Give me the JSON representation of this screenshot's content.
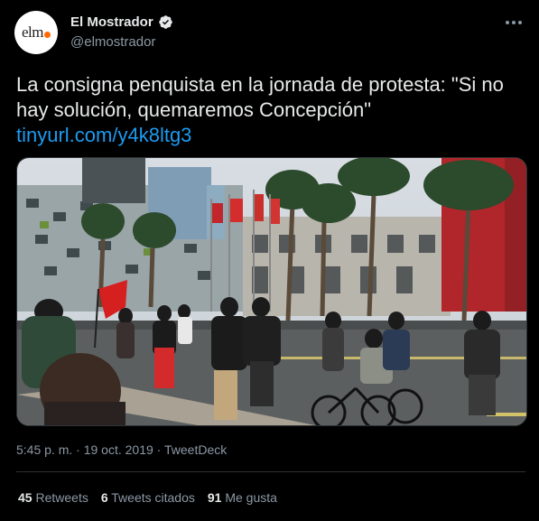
{
  "author": {
    "avatar_text": "elm",
    "display_name": "El Mostrador",
    "handle": "@elmostrador"
  },
  "tweet": {
    "text": "La consigna penquista en la jornada de protesta: \"Si no hay solución, quemaremos Concepción\"",
    "link": "tinyurl.com/y4k8ltg3"
  },
  "media": {
    "alt": "Protesters walking on a street with flags and palm trees, one carrying a red flag, people on bicycles"
  },
  "meta": {
    "time": "5:45 p. m.",
    "separator": " · ",
    "date": "19 oct. 2019",
    "source": "TweetDeck"
  },
  "stats": [
    {
      "count": "45",
      "label": "Retweets"
    },
    {
      "count": "6",
      "label": "Tweets citados"
    },
    {
      "count": "91",
      "label": "Me gusta"
    }
  ],
  "colors": {
    "background": "#000000",
    "link": "#1d9bf0",
    "secondary_text": "#8b98a5",
    "primary_text": "#e7e9ea",
    "accent_avatar": "#ff6a00"
  },
  "icons": {
    "verified": "verified-badge-icon",
    "more": "more-dots-icon"
  }
}
